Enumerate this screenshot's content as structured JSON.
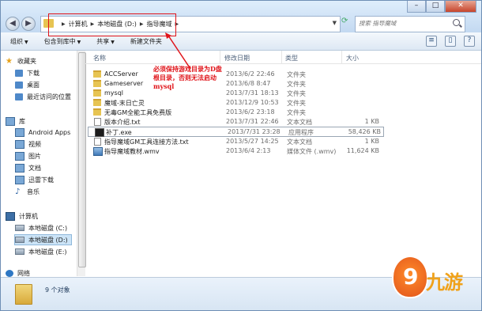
{
  "window": {
    "minimize": "–",
    "maximize": "□",
    "close": "✕"
  },
  "address": {
    "crumbs": [
      "计算机",
      "本地磁盘 (D:)",
      "指导魔域"
    ]
  },
  "search": {
    "placeholder": "搜索 指导魔域"
  },
  "toolbar": {
    "organize": "组织",
    "include_in_library": "包含到库中",
    "share": "共享",
    "new_folder": "新建文件夹"
  },
  "sidebar": {
    "favorites": "收藏夹",
    "fav_items": [
      "下载",
      "桌面",
      "最近访问的位置"
    ],
    "libraries": "库",
    "lib_items": [
      "Android Apps",
      "视频",
      "图片",
      "文档",
      "迅雷下载",
      "音乐"
    ],
    "computer": "计算机",
    "drives": [
      "本地磁盘 (C:)",
      "本地磁盘 (D:)",
      "本地磁盘 (E:)"
    ],
    "network": "网络"
  },
  "columns": {
    "name": "名称",
    "date": "修改日期",
    "type": "类型",
    "size": "大小"
  },
  "files": [
    {
      "name": "ACCServer",
      "date": "2013/6/2 22:46",
      "type": "文件夹",
      "size": "",
      "icon": "folder-icon"
    },
    {
      "name": "Gameserver",
      "date": "2013/6/8 8:47",
      "type": "文件夹",
      "size": "",
      "icon": "folder-icon"
    },
    {
      "name": "mysql",
      "date": "2013/7/31 18:13",
      "type": "文件夹",
      "size": "",
      "icon": "folder-icon"
    },
    {
      "name": "魔域-末日亡灵",
      "date": "2013/12/9 10:53",
      "type": "文件夹",
      "size": "",
      "icon": "folder-icon"
    },
    {
      "name": "无毒GM全能工具免费版",
      "date": "2013/6/2 23:18",
      "type": "文件夹",
      "size": "",
      "icon": "folder-icon"
    },
    {
      "name": "版本介绍.txt",
      "date": "2013/7/31 22:46",
      "type": "文本文档",
      "size": "1 KB",
      "icon": "text-file-icon"
    },
    {
      "name": "补丁.exe",
      "date": "2013/7/31 23:28",
      "type": "应用程序",
      "size": "58,426 KB",
      "icon": "exe-icon"
    },
    {
      "name": "指导魔域GM工具连接方法.txt",
      "date": "2013/5/27 14:25",
      "type": "文本文档",
      "size": "1 KB",
      "icon": "text-file-icon"
    },
    {
      "name": "指导魔域教材.wmv",
      "date": "2013/6/4 2:13",
      "type": "媒体文件 (.wmv)",
      "size": "11,624 KB",
      "icon": "video-file-icon"
    }
  ],
  "annotation": {
    "lines": [
      "必须保持游戏目录为D盘",
      "根目录，否则无法启动",
      "mysql"
    ],
    "color": "#e0141a"
  },
  "status": {
    "count": "9 个对象"
  },
  "watermark": {
    "text": "九游",
    "logo_glyph": "9"
  }
}
